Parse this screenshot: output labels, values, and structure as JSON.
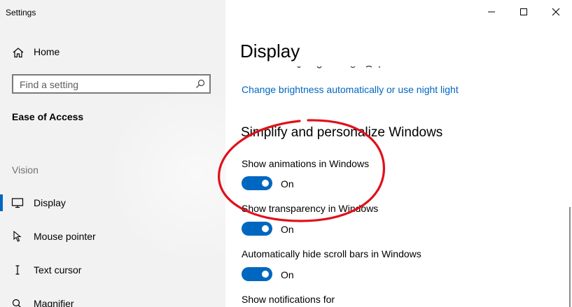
{
  "window": {
    "app_title": "Settings",
    "controls": [
      "minimize",
      "maximize",
      "close"
    ]
  },
  "sidebar": {
    "home_label": "Home",
    "search": {
      "placeholder": "Find a setting",
      "value": ""
    },
    "section_heading": "Ease of Access",
    "group_label": "Vision",
    "items": [
      {
        "label": "Display",
        "icon": "monitor-icon",
        "selected": true
      },
      {
        "label": "Mouse pointer",
        "icon": "mouse-pointer-icon",
        "selected": false
      },
      {
        "label": "Text cursor",
        "icon": "text-cursor-icon",
        "selected": false
      },
      {
        "label": "Magnifier",
        "icon": "magnifier-icon",
        "selected": false
      }
    ]
  },
  "main": {
    "title": "Display",
    "brightness_link": "Change brightness automatically or use night light",
    "section_heading": "Simplify and personalize Windows",
    "settings": [
      {
        "label": "Show animations in Windows",
        "state": "On",
        "enabled": true
      },
      {
        "label": "Show transparency in Windows",
        "state": "On",
        "enabled": true
      },
      {
        "label": "Automatically hide scroll bars in Windows",
        "state": "On",
        "enabled": true
      }
    ],
    "notifications_label": "Show notifications for"
  },
  "colors": {
    "accent": "#0067c0",
    "sidebar_bg": "#f2f2f2",
    "annotation": "#e0101a"
  }
}
